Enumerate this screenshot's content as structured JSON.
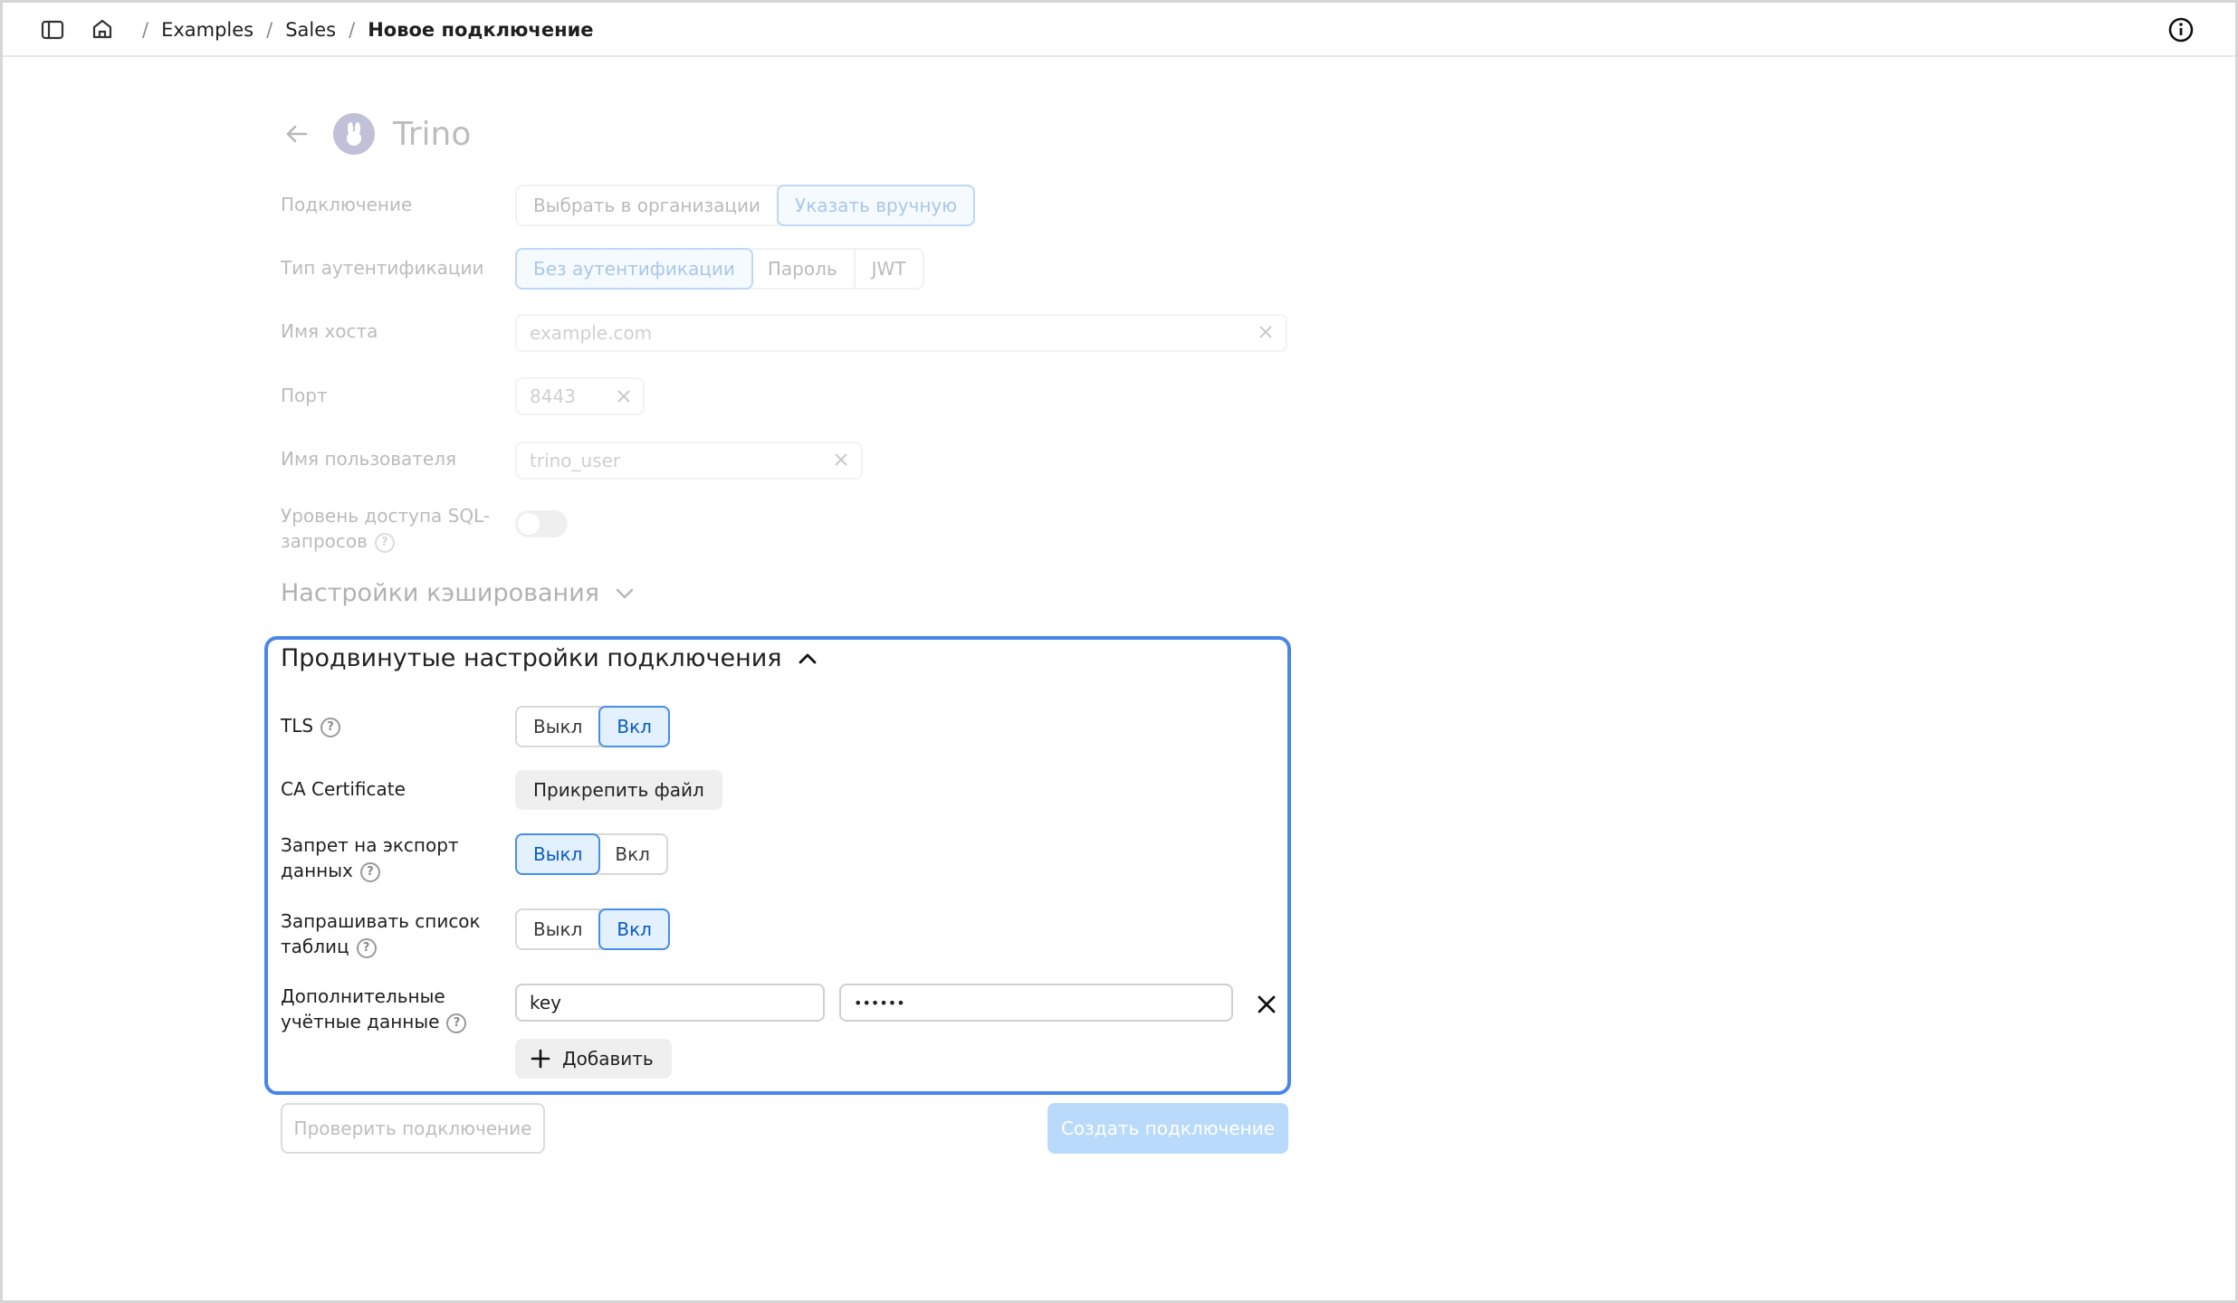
{
  "breadcrumb": {
    "items": [
      "Examples",
      "Sales"
    ],
    "current": "Новое подключение"
  },
  "header": {
    "title": "Trino"
  },
  "connection": {
    "label": "Подключение",
    "options": [
      "Выбрать в организации",
      "Указать вручную"
    ],
    "selected": "Указать вручную"
  },
  "auth": {
    "label": "Тип аутентификации",
    "options": [
      "Без аутентификации",
      "Пароль",
      "JWT"
    ],
    "selected": "Без аутентификации"
  },
  "host": {
    "label": "Имя хоста",
    "placeholder": "example.com"
  },
  "port": {
    "label": "Порт",
    "placeholder": "8443"
  },
  "user": {
    "label": "Имя пользователя",
    "placeholder": "trino_user"
  },
  "sql_access": {
    "label_line1": "Уровень доступа SQL-",
    "label_line2": "запросов",
    "enabled": false
  },
  "caching": {
    "title": "Настройки кэширования"
  },
  "advanced": {
    "title": "Продвинутые настройки подключения",
    "tls": {
      "label": "TLS",
      "options": [
        "Выкл",
        "Вкл"
      ],
      "selected": "Вкл"
    },
    "ca": {
      "label": "CA Certificate",
      "button": "Прикрепить файл"
    },
    "export_ban": {
      "label_line1": "Запрет на экспорт",
      "label_line2": "данных",
      "options": [
        "Выкл",
        "Вкл"
      ],
      "selected": "Выкл"
    },
    "table_list": {
      "label_line1": "Запрашивать список",
      "label_line2": "таблиц",
      "options": [
        "Выкл",
        "Вкл"
      ],
      "selected": "Вкл"
    },
    "extra_creds": {
      "label_line1": "Дополнительные",
      "label_line2": "учётные данные",
      "key_value": "key",
      "secret_value": "••••••"
    },
    "add_button": "Добавить"
  },
  "footer": {
    "check": "Проверить подключение",
    "create": "Создать подключение"
  },
  "colors": {
    "accent": "#4a86e8",
    "active_bg": "#e3f0fe",
    "primary_disabled": "#b9dafb"
  }
}
